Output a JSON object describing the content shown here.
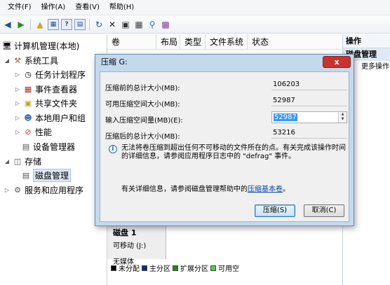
{
  "menu": {
    "items": [
      "文件(F)",
      "操作(A)",
      "查看(V)",
      "帮助(H)"
    ]
  },
  "toolbar": {
    "icons": [
      "back-arrow-icon",
      "forward-arrow-icon",
      "up-folder-icon",
      "show-tree-icon",
      "help-icon",
      "console-icon",
      "refresh-icon",
      "delete-icon",
      "properties-icon",
      "open-icon",
      "search-disk-icon",
      "format-icon"
    ]
  },
  "tree": {
    "root": "计算机管理(本地)",
    "system_tools": "系统工具",
    "task_scheduler": "任务计划程序",
    "event_viewer": "事件查看器",
    "shared_folders": "共享文件夹",
    "local_users": "本地用户和组",
    "performance": "性能",
    "device_manager": "设备管理器",
    "storage": "存储",
    "disk_management": "磁盘管理",
    "services_apps": "服务和应用程序"
  },
  "columns": [
    "卷",
    "布局",
    "类型",
    "文件系统",
    "状态"
  ],
  "actions": {
    "header": "操作",
    "section": "磁盘管理",
    "more": "更多操作"
  },
  "disk": {
    "name": "磁盘 1",
    "type": "可移动 (J:)",
    "media": "无媒体"
  },
  "legend": {
    "items": [
      {
        "label": "未分配",
        "color": "#000000"
      },
      {
        "label": "主分区",
        "color": "#0a2a8c"
      },
      {
        "label": "扩展分区",
        "color": "#1f8a1f"
      },
      {
        "label": "可用空",
        "color": "#43d643"
      }
    ]
  },
  "dialog": {
    "title": "压缩 G:",
    "close": "x",
    "total_before_label": "压缩前的总计大小(MB):",
    "total_before_value": "106203",
    "available_label": "可用压缩空间大小(MB):",
    "available_value": "52987",
    "input_label": "输入压缩空间量(MB)(E):",
    "input_value": "52987",
    "total_after_label": "压缩后的总计大小(MB):",
    "total_after_value": "53216",
    "info_text": "无法将卷压缩到超出任何不可移动的文件所在的点。有关完成该操作时间的详细信息，请参阅应用程序日志中的 \"defrag\" 事件。",
    "help_prefix": "有关详细信息，请参阅磁盘管理帮助中的",
    "help_link": "压缩基本卷",
    "help_suffix": "。",
    "ok_label": "压缩(S)",
    "cancel_label": "取消(C)"
  }
}
